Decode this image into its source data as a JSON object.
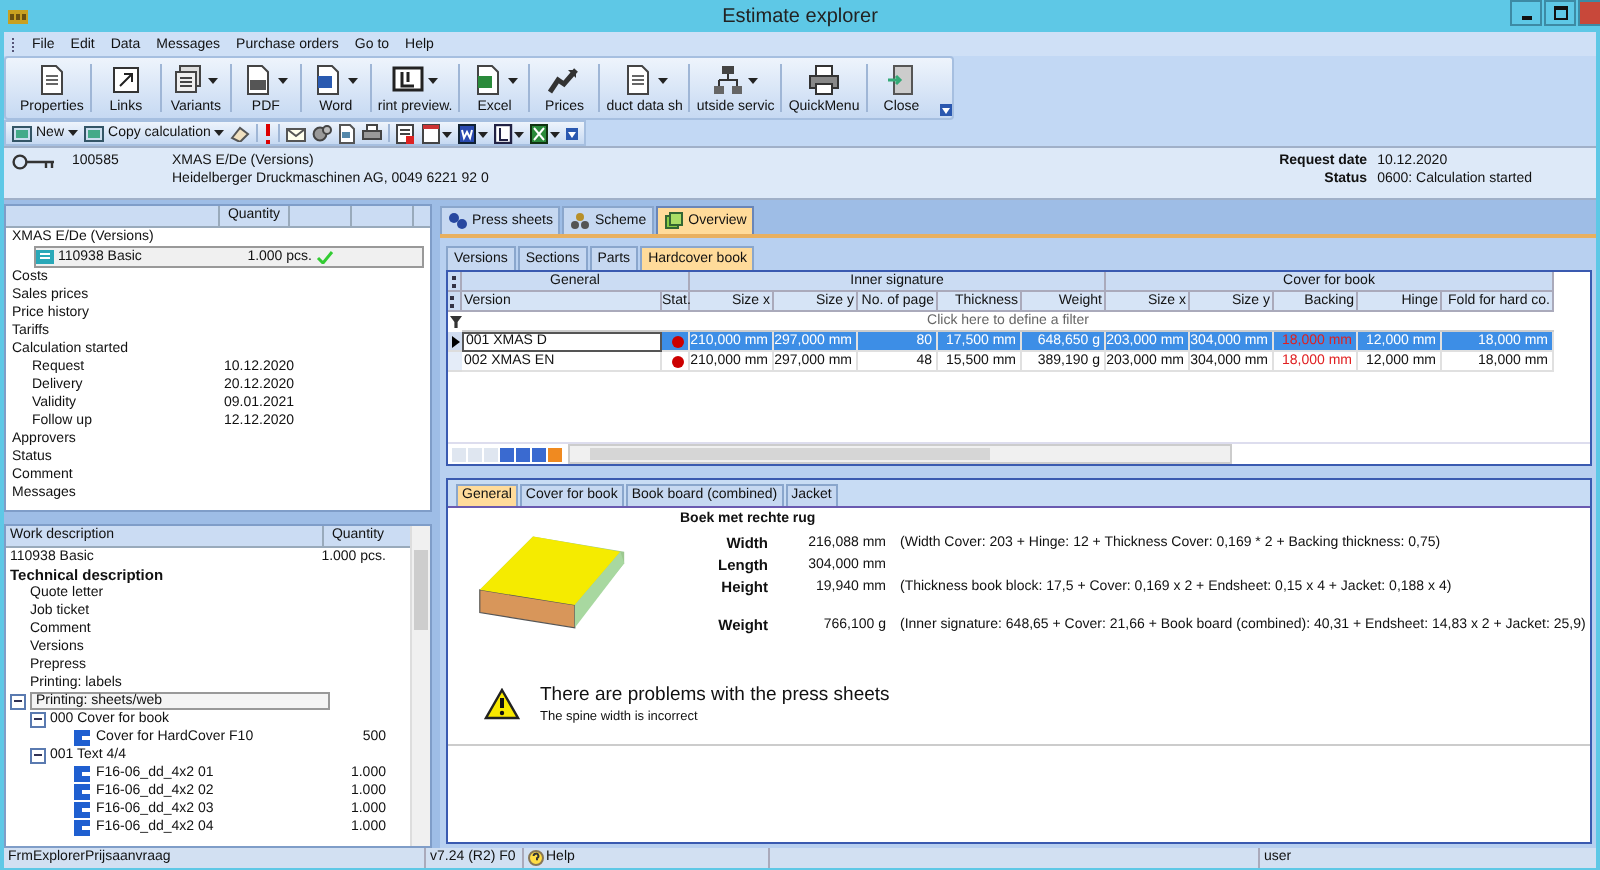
{
  "window": {
    "title": "Estimate explorer"
  },
  "menu": [
    {
      "label": "File"
    },
    {
      "label": "Edit"
    },
    {
      "label": "Data"
    },
    {
      "label": "Messages"
    },
    {
      "label": "Purchase orders"
    },
    {
      "label": "Go to"
    },
    {
      "label": "Help"
    }
  ],
  "toolbar": [
    {
      "label": "Properties",
      "dropdown": false
    },
    {
      "label": "Links",
      "dropdown": false
    },
    {
      "label": "Variants",
      "dropdown": true
    },
    {
      "label": "PDF",
      "dropdown": true
    },
    {
      "label": "Word",
      "dropdown": true
    },
    {
      "label": "rint preview.",
      "dropdown": true
    },
    {
      "label": "Excel",
      "dropdown": true
    },
    {
      "label": "Prices",
      "dropdown": false
    },
    {
      "label": "duct data sh",
      "dropdown": true
    },
    {
      "label": "utside servic",
      "dropdown": true
    },
    {
      "label": "QuickMenu",
      "dropdown": false
    },
    {
      "label": "Close",
      "dropdown": false
    }
  ],
  "quick_toolbar": [
    {
      "label": "New"
    },
    {
      "label": "Copy calculation"
    }
  ],
  "header": {
    "number": "100585",
    "name": "XMAS E/De (Versions)",
    "company": "Heidelberger Druckmaschinen AG, 0049 6221 92 0",
    "request_date_label": "Request date",
    "request_date": "10.12.2020",
    "status_label": "Status",
    "status": "0600: Calculation started"
  },
  "overview_panel": {
    "column_header": "Quantity",
    "title": "XMAS E/De (Versions)",
    "version": {
      "label": "110938 Basic",
      "quantity": "1.000 pcs.",
      "approved": true
    },
    "items": [
      {
        "label": "Costs"
      },
      {
        "label": "Sales prices"
      },
      {
        "label": "Price history"
      },
      {
        "label": "Tariffs"
      },
      {
        "label": "Calculation started",
        "children": [
          {
            "label": "Request",
            "value": "10.12.2020"
          },
          {
            "label": "Delivery",
            "value": "20.12.2020"
          },
          {
            "label": "Validity",
            "value": "09.01.2021"
          },
          {
            "label": "Follow up",
            "value": "12.12.2020"
          }
        ]
      },
      {
        "label": "Approvers"
      },
      {
        "label": "Status"
      },
      {
        "label": "Comment"
      },
      {
        "label": "Messages"
      }
    ]
  },
  "work_tree": {
    "columns": [
      "Work description",
      "Quantity"
    ],
    "rows": [
      {
        "kind": "text",
        "label": "110938 Basic",
        "value": "1.000 pcs.",
        "selected": false
      },
      {
        "kind": "heading",
        "label": "Technical description",
        "selected": false,
        "children": [
          {
            "kind": "text",
            "label": "Quote letter",
            "selected": false
          },
          {
            "kind": "text",
            "label": "Job ticket",
            "selected": false
          },
          {
            "kind": "text",
            "label": "Comment",
            "selected": false
          },
          {
            "kind": "text",
            "label": "Versions",
            "selected": false
          },
          {
            "kind": "text",
            "label": "Prepress",
            "selected": false
          },
          {
            "kind": "text",
            "label": "Printing: labels",
            "selected": false
          }
        ]
      },
      {
        "kind": "group",
        "label": "Printing: sheets/web",
        "expanded": true,
        "selected": true,
        "children": [
          {
            "kind": "group",
            "label": "000 Cover for book",
            "expanded": true,
            "selected": false,
            "children": [
              {
                "kind": "sheet",
                "label": "Cover for HardCover F10",
                "value": "500",
                "selected": false
              }
            ]
          },
          {
            "kind": "group",
            "label": "001 Text 4/4",
            "expanded": true,
            "selected": false,
            "children": [
              {
                "kind": "sheet",
                "label": "F16-06_dd_4x2 01",
                "value": "1.000",
                "selected": false
              },
              {
                "kind": "sheet",
                "label": "F16-06_dd_4x2 02",
                "value": "1.000",
                "selected": false
              },
              {
                "kind": "sheet",
                "label": "F16-06_dd_4x2 03",
                "value": "1.000",
                "selected": false
              },
              {
                "kind": "sheet",
                "label": "F16-06_dd_4x2 04",
                "value": "1.000",
                "selected": false
              }
            ]
          }
        ]
      }
    ]
  },
  "main_tabs": [
    {
      "label": "Press sheets",
      "selected": false
    },
    {
      "label": "Scheme",
      "selected": false
    },
    {
      "label": "Overview",
      "selected": true
    }
  ],
  "sub_tabs": [
    {
      "label": "Versions",
      "selected": false
    },
    {
      "label": "Sections",
      "selected": false
    },
    {
      "label": "Parts",
      "selected": false
    },
    {
      "label": "Hardcover book",
      "selected": true
    }
  ],
  "grid": {
    "bands": [
      {
        "label": "General"
      },
      {
        "label": "Inner signature"
      },
      {
        "label": "Cover for book"
      }
    ],
    "columns": [
      {
        "label": "Version",
        "kind": "name"
      },
      {
        "label": "Stat.",
        "kind": "status"
      },
      {
        "label": "Size x",
        "kind": "measure"
      },
      {
        "label": "Size y",
        "kind": "measure"
      },
      {
        "label": "No. of page",
        "kind": "measure"
      },
      {
        "label": "Thickness",
        "kind": "measure"
      },
      {
        "label": "Weight",
        "kind": "measure"
      },
      {
        "label": "Size x",
        "kind": "measure"
      },
      {
        "label": "Size y",
        "kind": "measure"
      },
      {
        "label": "Backing",
        "kind": "backing"
      },
      {
        "label": "Hinge",
        "kind": "measure"
      },
      {
        "label": "Fold for hard co.",
        "kind": "measure"
      }
    ],
    "filter_hint": "Click here to define a filter",
    "rows": [
      {
        "selected": true,
        "color": "#cc0000",
        "backing_warning": true,
        "cells": [
          "001 XMAS D",
          "",
          "210,000 mm",
          "297,000 mm",
          "80",
          "17,500 mm",
          "648,650 g",
          "203,000 mm",
          "304,000 mm",
          "18,000 mm",
          "12,000 mm",
          "18,000 mm"
        ]
      },
      {
        "selected": false,
        "color": "#cc0000",
        "backing_warning": true,
        "cells": [
          "002 XMAS EN",
          "",
          "210,000 mm",
          "297,000 mm",
          "48",
          "15,500 mm",
          "389,190 g",
          "203,000 mm",
          "304,000 mm",
          "18,000 mm",
          "12,000 mm",
          "18,000 mm"
        ]
      }
    ]
  },
  "detail_tabs": [
    {
      "label": "General",
      "selected": true
    },
    {
      "label": "Cover for book",
      "selected": false
    },
    {
      "label": "Book board (combined)",
      "selected": false
    },
    {
      "label": "Jacket",
      "selected": false
    }
  ],
  "detail": {
    "title": "Boek met rechte rug",
    "rows": [
      {
        "label": "Width",
        "value": "216,088 mm",
        "formula": "(Width Cover: 203 + Hinge: 12 + Thickness Cover: 0,169 * 2  + Backing thickness: 0,75)"
      },
      {
        "label": "Length",
        "value": "304,000 mm"
      },
      {
        "label": "Height",
        "value": "19,940 mm",
        "formula": "(Thickness book block: 17,5 + Cover: 0,169 x 2 + Endsheet: 0,15 x 4 + Jacket: 0,188 x 4)"
      },
      {
        "label": "Weight",
        "value": "766,100 g",
        "formula": "(Inner signature: 648,65 + Cover: 21,66 + Book board (combined): 40,31 + Endsheet: 14,83 x 2 + Jacket: 25,9)"
      }
    ],
    "warning_title": "There are problems with the press sheets",
    "warning_message": "The spine width is incorrect"
  },
  "status_bar": {
    "form": "FrmExplorerPrijsaanvraag",
    "version": "v7.24 (R2) F0",
    "help": "Help",
    "user": "user"
  }
}
